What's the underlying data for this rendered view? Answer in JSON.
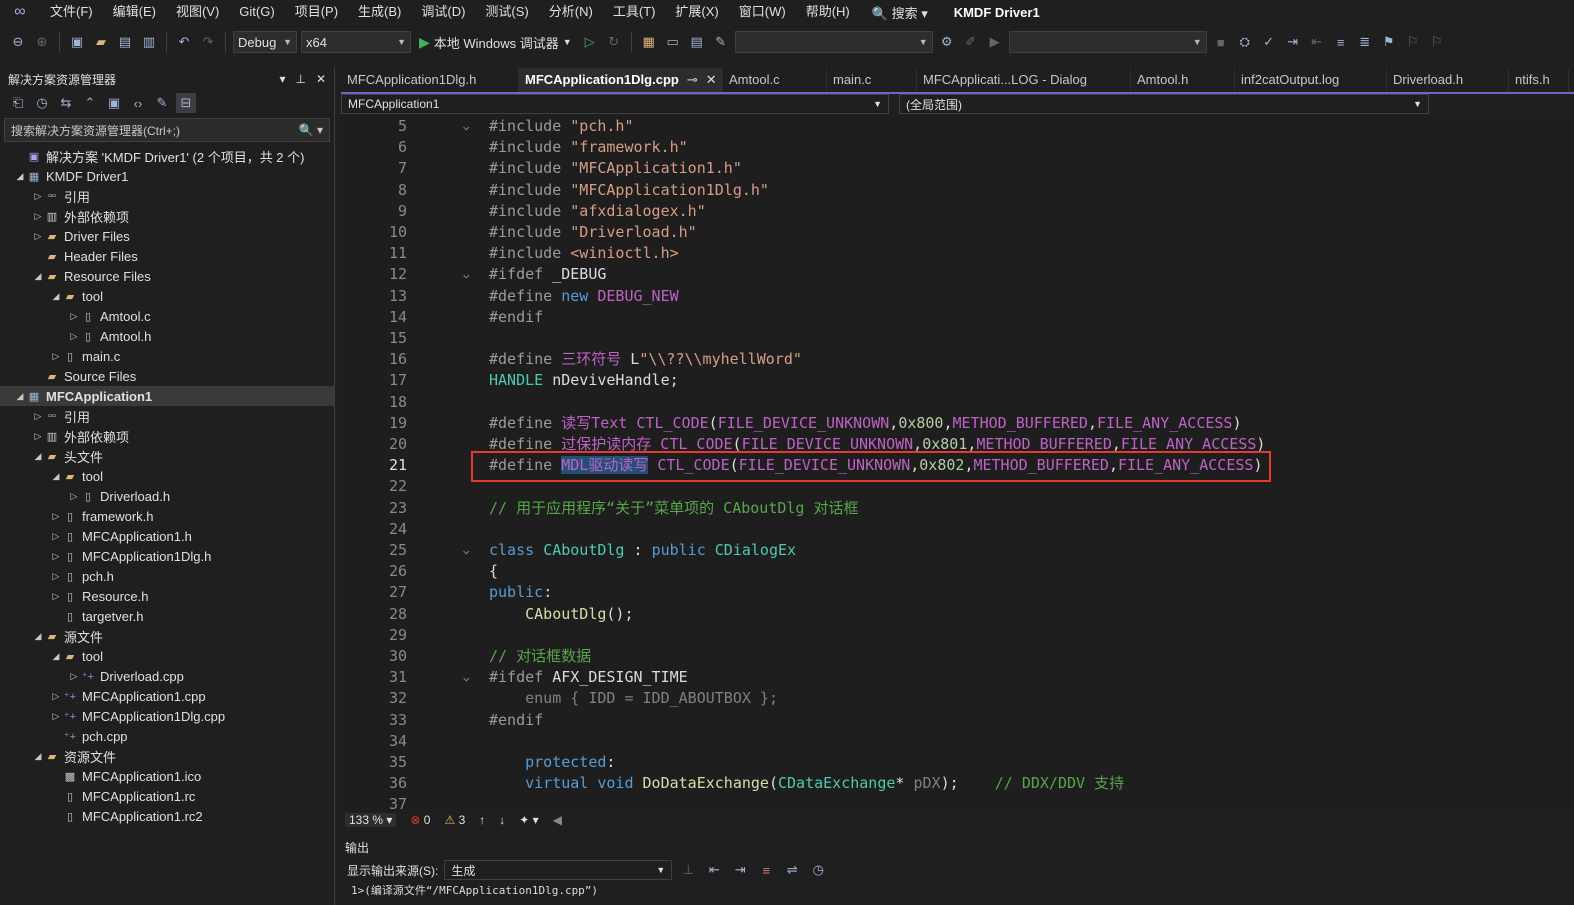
{
  "menu": [
    "文件(F)",
    "编辑(E)",
    "视图(V)",
    "Git(G)",
    "项目(P)",
    "生成(B)",
    "调试(D)",
    "测试(S)",
    "分析(N)",
    "工具(T)",
    "扩展(X)",
    "窗口(W)",
    "帮助(H)"
  ],
  "search_label": "搜索",
  "window_title": "KMDF Driver1",
  "toolbar": {
    "config": "Debug",
    "platform": "x64",
    "run_label": "本地 Windows 调试器"
  },
  "solution_explorer": {
    "title": "解决方案资源管理器",
    "search_placeholder": "搜索解决方案资源管理器(Ctrl+;)",
    "tree": [
      {
        "label": "解决方案 'KMDF Driver1' (2 个项目，共 2 个)",
        "icon": "solution-icon",
        "arrow": "",
        "indent": 0
      },
      {
        "label": "KMDF Driver1",
        "icon": "project-icon",
        "arrow": "down",
        "indent": 0
      },
      {
        "label": "引用",
        "icon": "reference-icon",
        "arrow": "right",
        "indent": 1
      },
      {
        "label": "外部依赖项",
        "icon": "external-deps-icon",
        "arrow": "right",
        "indent": 1
      },
      {
        "label": "Driver Files",
        "icon": "folder-icon",
        "arrow": "right",
        "indent": 1
      },
      {
        "label": "Header Files",
        "icon": "folder-icon",
        "arrow": "",
        "indent": 1
      },
      {
        "label": "Resource Files",
        "icon": "folder-icon",
        "arrow": "down",
        "indent": 1
      },
      {
        "label": "tool",
        "icon": "folder-icon",
        "arrow": "down",
        "indent": 2
      },
      {
        "label": "Amtool.c",
        "icon": "file-icon",
        "arrow": "right",
        "indent": 3
      },
      {
        "label": "Amtool.h",
        "icon": "file-icon",
        "arrow": "right",
        "indent": 3
      },
      {
        "label": "main.c",
        "icon": "file-icon",
        "arrow": "right",
        "indent": 2
      },
      {
        "label": "Source Files",
        "icon": "folder-icon",
        "arrow": "",
        "indent": 1
      },
      {
        "label": "MFCApplication1",
        "icon": "project-icon",
        "arrow": "down",
        "indent": 0,
        "bold": true,
        "selected": true
      },
      {
        "label": "引用",
        "icon": "reference-icon",
        "arrow": "right",
        "indent": 1
      },
      {
        "label": "外部依赖项",
        "icon": "external-deps-icon",
        "arrow": "right",
        "indent": 1
      },
      {
        "label": "头文件",
        "icon": "folder-icon",
        "arrow": "down",
        "indent": 1
      },
      {
        "label": "tool",
        "icon": "folder-icon",
        "arrow": "down",
        "indent": 2
      },
      {
        "label": "Driverload.h",
        "icon": "file-icon",
        "arrow": "right",
        "indent": 3
      },
      {
        "label": "framework.h",
        "icon": "file-icon",
        "arrow": "right",
        "indent": 2
      },
      {
        "label": "MFCApplication1.h",
        "icon": "file-icon",
        "arrow": "right",
        "indent": 2
      },
      {
        "label": "MFCApplication1Dlg.h",
        "icon": "file-icon",
        "arrow": "right",
        "indent": 2
      },
      {
        "label": "pch.h",
        "icon": "file-icon",
        "arrow": "right",
        "indent": 2
      },
      {
        "label": "Resource.h",
        "icon": "file-icon",
        "arrow": "right",
        "indent": 2
      },
      {
        "label": "targetver.h",
        "icon": "file-icon",
        "arrow": "",
        "indent": 2
      },
      {
        "label": "源文件",
        "icon": "folder-icon",
        "arrow": "down",
        "indent": 1
      },
      {
        "label": "tool",
        "icon": "folder-icon",
        "arrow": "down",
        "indent": 2
      },
      {
        "label": "Driverload.cpp",
        "icon": "cpp-file-icon",
        "arrow": "right",
        "indent": 3
      },
      {
        "label": "MFCApplication1.cpp",
        "icon": "cpp-file-icon",
        "arrow": "right",
        "indent": 2
      },
      {
        "label": "MFCApplication1Dlg.cpp",
        "icon": "cpp-file-icon",
        "arrow": "right",
        "indent": 2
      },
      {
        "label": "pch.cpp",
        "icon": "cpp-file-icon",
        "arrow": "",
        "indent": 2
      },
      {
        "label": "资源文件",
        "icon": "folder-icon",
        "arrow": "down",
        "indent": 1
      },
      {
        "label": "MFCApplication1.ico",
        "icon": "image-file-icon",
        "arrow": "",
        "indent": 2
      },
      {
        "label": "MFCApplication1.rc",
        "icon": "file-icon",
        "arrow": "",
        "indent": 2
      },
      {
        "label": "MFCApplication1.rc2",
        "icon": "file-icon",
        "arrow": "",
        "indent": 2
      }
    ]
  },
  "tabs": [
    {
      "label": "MFCApplication1Dlg.h",
      "active": false
    },
    {
      "label": "MFCApplication1Dlg.cpp",
      "active": true
    },
    {
      "label": "Amtool.c",
      "active": false
    },
    {
      "label": "main.c",
      "active": false
    },
    {
      "label": "MFCApplicati...LOG - Dialog",
      "active": false
    },
    {
      "label": "Amtool.h",
      "active": false
    },
    {
      "label": "inf2catOutput.log",
      "active": false
    },
    {
      "label": "Driverload.h",
      "active": false
    },
    {
      "label": "ntifs.h",
      "active": false
    }
  ],
  "nav": {
    "project": "MFCApplication1",
    "scope": "(全局范围)"
  },
  "code": [
    {
      "n": "5",
      "fold": "open",
      "t": [
        [
          "pp",
          "#include "
        ],
        [
          "str",
          "\"pch.h\""
        ]
      ]
    },
    {
      "n": "6",
      "t": [
        [
          "pp",
          "#include "
        ],
        [
          "str",
          "\"framework.h\""
        ]
      ]
    },
    {
      "n": "7",
      "t": [
        [
          "pp",
          "#include "
        ],
        [
          "str",
          "\"MFCApplication1.h\""
        ]
      ]
    },
    {
      "n": "8",
      "t": [
        [
          "pp",
          "#include "
        ],
        [
          "str",
          "\"MFCApplication1Dlg.h\""
        ]
      ]
    },
    {
      "n": "9",
      "t": [
        [
          "pp",
          "#include "
        ],
        [
          "str",
          "\"afxdialogex.h\""
        ]
      ]
    },
    {
      "n": "10",
      "t": [
        [
          "pp",
          "#include "
        ],
        [
          "str",
          "\"Driverload.h\""
        ]
      ]
    },
    {
      "n": "11",
      "t": [
        [
          "pp",
          "#include "
        ],
        [
          "str",
          "<winioctl.h>"
        ]
      ]
    },
    {
      "n": "12",
      "fold": "open",
      "t": [
        [
          "pp",
          "#ifdef "
        ],
        [
          "ident",
          "_DEBUG"
        ]
      ]
    },
    {
      "n": "13",
      "t": [
        [
          "pp",
          "#define "
        ],
        [
          "kw",
          "new "
        ],
        [
          "mac",
          "DEBUG_NEW"
        ]
      ]
    },
    {
      "n": "14",
      "t": [
        [
          "pp",
          "#endif"
        ]
      ]
    },
    {
      "n": "15",
      "t": []
    },
    {
      "n": "16",
      "t": [
        [
          "pp",
          "#define "
        ],
        [
          "mac",
          "三环符号"
        ],
        [
          "ident",
          " L"
        ],
        [
          "str",
          "\"\\\\??\\\\myhellWord\""
        ]
      ]
    },
    {
      "n": "17",
      "t": [
        [
          "ty",
          "HANDLE "
        ],
        [
          "ident",
          "nDeviveHandle;"
        ]
      ]
    },
    {
      "n": "18",
      "t": []
    },
    {
      "n": "19",
      "t": [
        [
          "pp",
          "#define "
        ],
        [
          "mac",
          "读写Text "
        ],
        [
          "mac",
          "CTL_CODE"
        ],
        [
          "ident",
          "("
        ],
        [
          "mac",
          "FILE_DEVICE_UNKNOWN"
        ],
        [
          "ident",
          ","
        ],
        [
          "num",
          "0x800"
        ],
        [
          "ident",
          ","
        ],
        [
          "mac",
          "METHOD_BUFFERED"
        ],
        [
          "ident",
          ","
        ],
        [
          "mac",
          "FILE_ANY_ACCESS"
        ],
        [
          "ident",
          ")"
        ]
      ]
    },
    {
      "n": "20",
      "t": [
        [
          "pp",
          "#define "
        ],
        [
          "mac",
          "过保护读内存 "
        ],
        [
          "mac",
          "CTL_CODE"
        ],
        [
          "ident",
          "("
        ],
        [
          "mac",
          "FILE_DEVICE_UNKNOWN"
        ],
        [
          "ident",
          ","
        ],
        [
          "num",
          "0x801"
        ],
        [
          "ident",
          ","
        ],
        [
          "mac",
          "METHOD_BUFFERED"
        ],
        [
          "ident",
          ","
        ],
        [
          "mac",
          "FILE_ANY_ACCESS"
        ],
        [
          "ident",
          ")"
        ]
      ]
    },
    {
      "n": "21",
      "cur": true,
      "t": [
        [
          "pp",
          "#define "
        ],
        [
          "mac hl",
          "MDL驱动读写"
        ],
        [
          "ident",
          " "
        ],
        [
          "mac",
          "CTL_CODE"
        ],
        [
          "ident",
          "("
        ],
        [
          "mac",
          "FILE_DEVICE_UNKNOWN"
        ],
        [
          "ident",
          ","
        ],
        [
          "num",
          "0x802"
        ],
        [
          "ident",
          ","
        ],
        [
          "mac",
          "METHOD_BUFFERED"
        ],
        [
          "ident",
          ","
        ],
        [
          "mac",
          "FILE_ANY_ACCESS"
        ],
        [
          "ident",
          ")"
        ]
      ]
    },
    {
      "n": "22",
      "t": []
    },
    {
      "n": "23",
      "t": [
        [
          "cm",
          "// 用于应用程序“关于”菜单项的 CAboutDlg 对话框"
        ]
      ]
    },
    {
      "n": "24",
      "t": []
    },
    {
      "n": "25",
      "fold": "open",
      "t": [
        [
          "kw",
          "class "
        ],
        [
          "ty",
          "CAboutDlg "
        ],
        [
          "ident",
          ": "
        ],
        [
          "kw",
          "public "
        ],
        [
          "ty",
          "CDialogEx"
        ]
      ]
    },
    {
      "n": "26",
      "t": [
        [
          "ident",
          "{"
        ]
      ]
    },
    {
      "n": "27",
      "t": [
        [
          "kw",
          "public"
        ],
        [
          "ident",
          ":"
        ]
      ]
    },
    {
      "n": "28",
      "t": [
        [
          "ident",
          "    "
        ],
        [
          "fn",
          "CAboutDlg"
        ],
        [
          "ident",
          "();"
        ]
      ]
    },
    {
      "n": "29",
      "t": []
    },
    {
      "n": "30",
      "t": [
        [
          "cm",
          "// 对话框数据"
        ]
      ]
    },
    {
      "n": "31",
      "fold": "open",
      "t": [
        [
          "pp",
          "#ifdef "
        ],
        [
          "ident",
          "AFX_DESIGN_TIME"
        ]
      ]
    },
    {
      "n": "32",
      "t": [
        [
          "gray",
          "    enum { IDD = IDD_ABOUTBOX };"
        ]
      ]
    },
    {
      "n": "33",
      "t": [
        [
          "pp",
          "#endif"
        ]
      ]
    },
    {
      "n": "34",
      "t": []
    },
    {
      "n": "35",
      "t": [
        [
          "ident",
          "    "
        ],
        [
          "kw",
          "protected"
        ],
        [
          "ident",
          ":"
        ]
      ]
    },
    {
      "n": "36",
      "t": [
        [
          "ident",
          "    "
        ],
        [
          "kw",
          "virtual void "
        ],
        [
          "fn",
          "DoDataExchange"
        ],
        [
          "ident",
          "("
        ],
        [
          "ty",
          "CDataExchange"
        ],
        [
          "ident",
          "* "
        ],
        [
          "gray",
          "pDX"
        ],
        [
          "ident",
          ");    "
        ],
        [
          "cm",
          "// DDX/DDV 支持"
        ]
      ]
    },
    {
      "n": "37",
      "t": []
    }
  ],
  "editor_status": {
    "zoom": "133 %",
    "errors": "0",
    "warnings": "3"
  },
  "output": {
    "title": "输出",
    "source_label": "显示输出来源(S):",
    "source_value": "生成",
    "line": "1>(编译源文件“/MFCApplication1Dlg.cpp”)"
  },
  "colors": {
    "accent": "#7b5fc7",
    "selection_box": "#e53935",
    "highlight": "#264f78"
  }
}
